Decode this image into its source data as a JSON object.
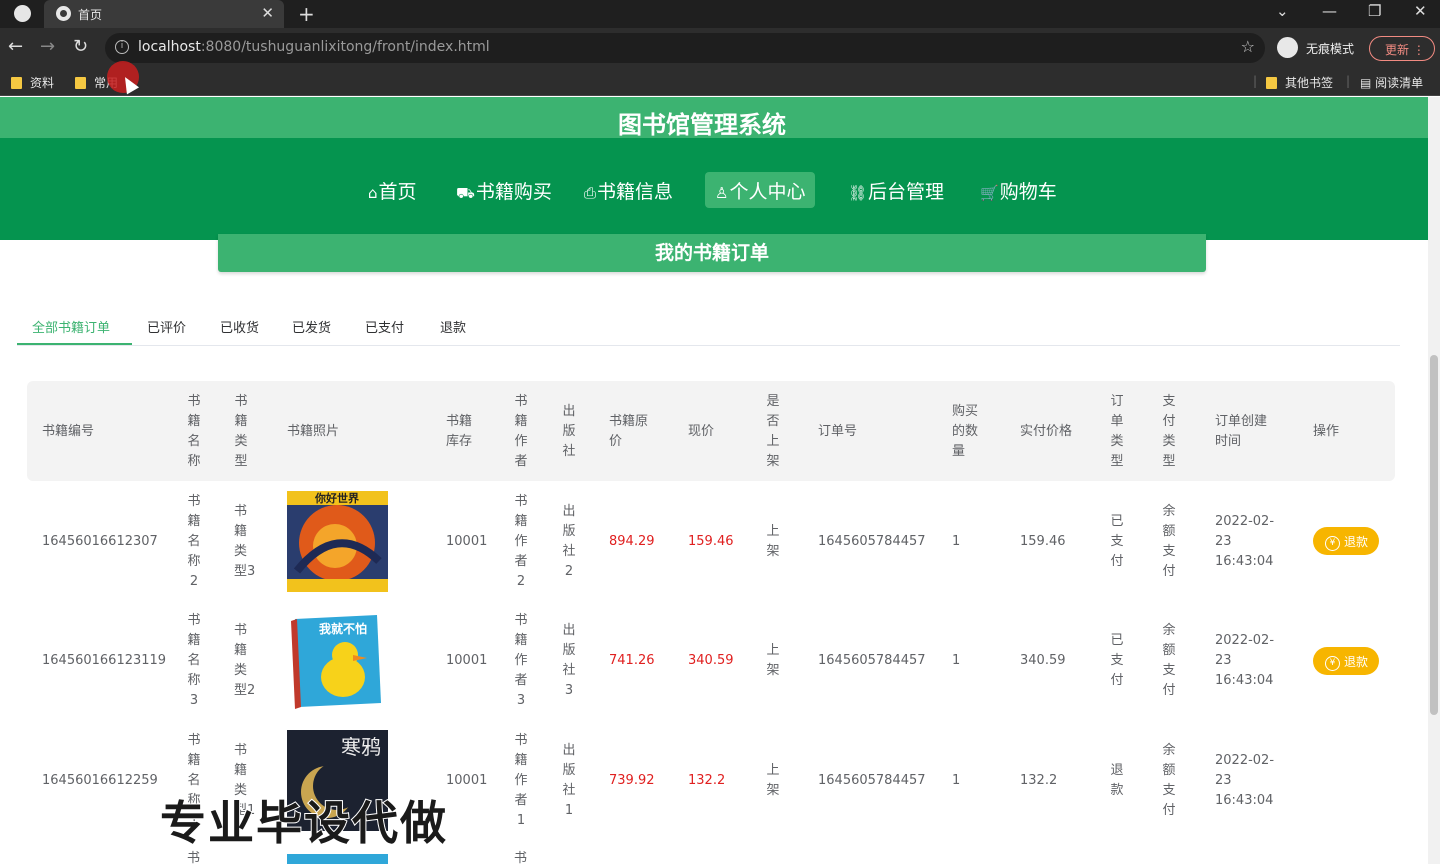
{
  "browser": {
    "tab_title": "首页",
    "url_host": "localhost",
    "url_rest": ":8080/tushuguanlixitong/front/index.html",
    "incognito_label": "无痕模式",
    "update_label": "更新",
    "bookmarks": [
      "资料",
      "常用"
    ],
    "bookmarks_right": [
      "其他书签",
      "阅读清单"
    ]
  },
  "site": {
    "title": "图书馆管理系统",
    "nav": [
      {
        "icon": "home-icon",
        "label": "首页"
      },
      {
        "icon": "cart-book-icon",
        "label": "书籍购买"
      },
      {
        "icon": "print-icon",
        "label": "书籍信息"
      },
      {
        "icon": "user-icon",
        "label": "个人中心"
      },
      {
        "icon": "link-icon",
        "label": "后台管理"
      },
      {
        "icon": "cart-icon",
        "label": "购物车"
      }
    ],
    "active_nav": "个人中心"
  },
  "orders": {
    "heading": "我的书籍订单",
    "tabs": [
      "全部书籍订单",
      "已评价",
      "已收货",
      "已发货",
      "已支付",
      "退款"
    ],
    "active_tab": "全部书籍订单",
    "columns": [
      "书籍编号",
      "书籍名称",
      "书籍类型",
      "书籍照片",
      "书籍库存",
      "书籍作者",
      "出版社",
      "书籍原价",
      "现价",
      "是否上架",
      "订单号",
      "购买的数量",
      "实付价格",
      "订单类型",
      "支付类型",
      "订单创建时间",
      "操作"
    ],
    "rows": [
      {
        "id": "16456016612307",
        "name": "书籍名称2",
        "type": "书籍类型3",
        "stock": "10001",
        "author": "书籍作者2",
        "publisher": "出版社2",
        "orig_price": "894.29",
        "price": "159.46",
        "on_shelf": "上架",
        "order_no": "1645605784457",
        "qty": "1",
        "paid": "159.46",
        "order_type": "已支付",
        "pay_type": "余额支付",
        "created": "2022-02-23 16:43:04",
        "action": "退款"
      },
      {
        "id": "164560166123119",
        "name": "书籍名称3",
        "type": "书籍类型2",
        "stock": "10001",
        "author": "书籍作者3",
        "publisher": "出版社3",
        "orig_price": "741.26",
        "price": "340.59",
        "on_shelf": "上架",
        "order_no": "1645605784457",
        "qty": "1",
        "paid": "340.59",
        "order_type": "已支付",
        "pay_type": "余额支付",
        "created": "2022-02-23 16:43:04",
        "action": "退款"
      },
      {
        "id": "16456016612259",
        "name": "书籍名称1",
        "type": "书籍类型1",
        "stock": "10001",
        "author": "书籍作者1",
        "publisher": "出版社1",
        "orig_price": "739.92",
        "price": "132.2",
        "on_shelf": "上架",
        "order_no": "1645605784457",
        "qty": "1",
        "paid": "132.2",
        "order_type": "退款",
        "pay_type": "余额支付",
        "created": "2022-02-23 16:43:04",
        "action": ""
      }
    ],
    "book_cover_texts": [
      "你好世界",
      "我就不怕",
      "寒鸦"
    ]
  },
  "watermark": "专业毕设代做",
  "colors": {
    "primary": "#05944f",
    "accent": "#3cb371",
    "price_red": "#e02020",
    "refund": "#f7b500"
  }
}
